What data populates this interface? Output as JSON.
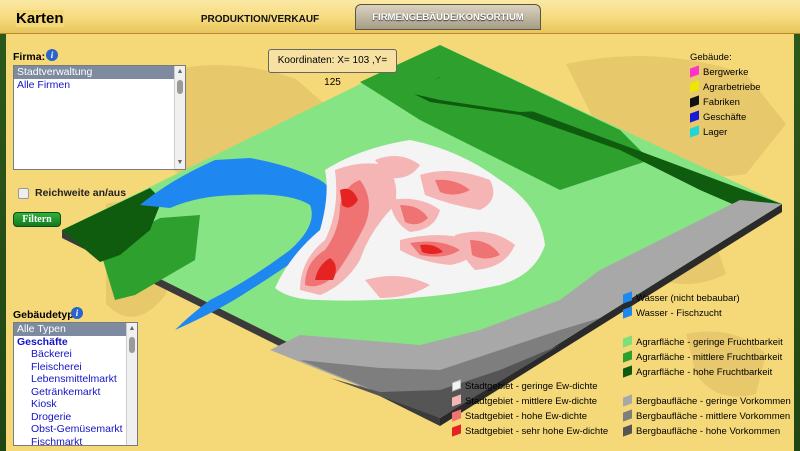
{
  "header": {
    "title": "Karten",
    "tabs": [
      {
        "label": "PRODUKTION/VERKAUF",
        "active": false
      },
      {
        "label": "FIRMENGEBÄUDE/KONSORTIUM",
        "active": true
      }
    ]
  },
  "firma": {
    "label": "Firma:",
    "items": [
      {
        "label": "Stadtverwaltung",
        "selected": true
      },
      {
        "label": "Alle Firmen",
        "selected": false
      }
    ]
  },
  "reichweite": {
    "label": "Reichweite an/aus",
    "checked": false
  },
  "filter_button": "Filtern",
  "coordinates": "Koordinaten: X= 103 ,Y= 125",
  "gebaeudetyp": {
    "label": "Gebäudetyp:",
    "items": [
      {
        "label": "Alle Typen",
        "kind": "sel"
      },
      {
        "label": "Geschäfte",
        "kind": "grp"
      },
      {
        "label": "Bäckerei",
        "kind": "sub"
      },
      {
        "label": "Fleischerei",
        "kind": "sub"
      },
      {
        "label": "Lebensmittelmarkt",
        "kind": "sub"
      },
      {
        "label": "Getränkemarkt",
        "kind": "sub"
      },
      {
        "label": "Kiosk",
        "kind": "sub"
      },
      {
        "label": "Drogerie",
        "kind": "sub"
      },
      {
        "label": "Obst-Gemüsemarkt",
        "kind": "sub"
      },
      {
        "label": "Fischmarkt",
        "kind": "sub"
      }
    ]
  },
  "gebaeude_legend": {
    "title": "Gebäude:",
    "items": [
      {
        "label": "Bergwerke",
        "color": "#ff33cc"
      },
      {
        "label": "Agrarbetriebe",
        "color": "#f2e600"
      },
      {
        "label": "Fabriken",
        "color": "#111111"
      },
      {
        "label": "Geschäfte",
        "color": "#1a1ad6"
      },
      {
        "label": "Lager",
        "color": "#22d6d6"
      }
    ]
  },
  "terrain_legend": {
    "water": [
      {
        "label": "Wasser (nicht bebaubar)",
        "color": "#1f88f0"
      },
      {
        "label": "Wasser - Fischzucht",
        "color": "#1f88f0"
      }
    ],
    "agrar": [
      {
        "label": "Agrarfläche - geringe Fruchtbarkeit",
        "color": "#7fe07a"
      },
      {
        "label": "Agrarfläche - mittlere Fruchtbarkeit",
        "color": "#2ea02e"
      },
      {
        "label": "Agrarfläche - hohe Fruchtbarkeit",
        "color": "#0e5a0e"
      }
    ],
    "stadt": [
      {
        "label": "Stadtgebiet - geringe Ew-dichte",
        "color": "#f4f4f4"
      },
      {
        "label": "Stadtgebiet - mittlere Ew-dichte",
        "color": "#f5b5b5"
      },
      {
        "label": "Stadtgebiet - hohe Ew-dichte",
        "color": "#ef7373"
      },
      {
        "label": "Stadtgebiet - sehr hohe Ew-dichte",
        "color": "#e52323"
      }
    ],
    "berg": [
      {
        "label": "Bergbaufläche - geringe Vorkommen",
        "color": "#a8a8a8"
      },
      {
        "label": "Bergbaufläche - mittlere Vorkommen",
        "color": "#7e7e7e"
      },
      {
        "label": "Bergbaufläche - hohe Vorkommen",
        "color": "#555555"
      }
    ]
  }
}
